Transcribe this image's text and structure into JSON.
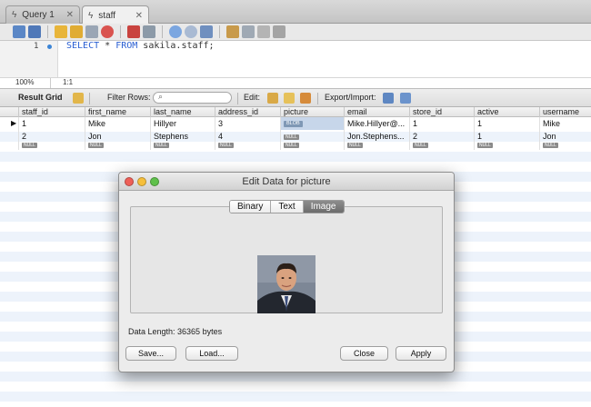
{
  "tabs": [
    {
      "label": "Query 1",
      "close": "✕"
    },
    {
      "label": "staff",
      "close": "✕"
    }
  ],
  "editor": {
    "line_number": "1",
    "sql_keyword1": "SELECT",
    "sql_star": " * ",
    "sql_keyword2": "FROM",
    "sql_rest": " sakila.staff;"
  },
  "status": {
    "zoom": "100%",
    "position": "1:1"
  },
  "result_toolbar": {
    "result_grid": "Result Grid",
    "filter_rows": "Filter Rows:",
    "edit": "Edit:",
    "export_import": "Export/Import:"
  },
  "grid": {
    "columns": [
      "staff_id",
      "first_name",
      "last_name",
      "address_id",
      "picture",
      "email",
      "store_id",
      "active",
      "username"
    ],
    "rows": [
      {
        "staff_id": "1",
        "first_name": "Mike",
        "last_name": "Hillyer",
        "address_id": "3",
        "picture": "BLOB",
        "email": "Mike.Hillyer@...",
        "store_id": "1",
        "active": "1",
        "username": "Mike"
      },
      {
        "staff_id": "2",
        "first_name": "Jon",
        "last_name": "Stephens",
        "address_id": "4",
        "picture": "NULL",
        "email": "Jon.Stephens...",
        "store_id": "2",
        "active": "1",
        "username": "Jon"
      }
    ],
    "null_label": "NULL"
  },
  "dialog": {
    "title": "Edit Data for picture",
    "tabs": [
      "Binary",
      "Text",
      "Image"
    ],
    "active_tab": "Image",
    "data_length": "Data Length: 36365 bytes",
    "save": "Save...",
    "load": "Load...",
    "close": "Close",
    "apply": "Apply"
  },
  "colors": {
    "keyword": "#2a5fd2",
    "blob_badge": "#7f98b5",
    "stripe": "#edf3fb"
  }
}
